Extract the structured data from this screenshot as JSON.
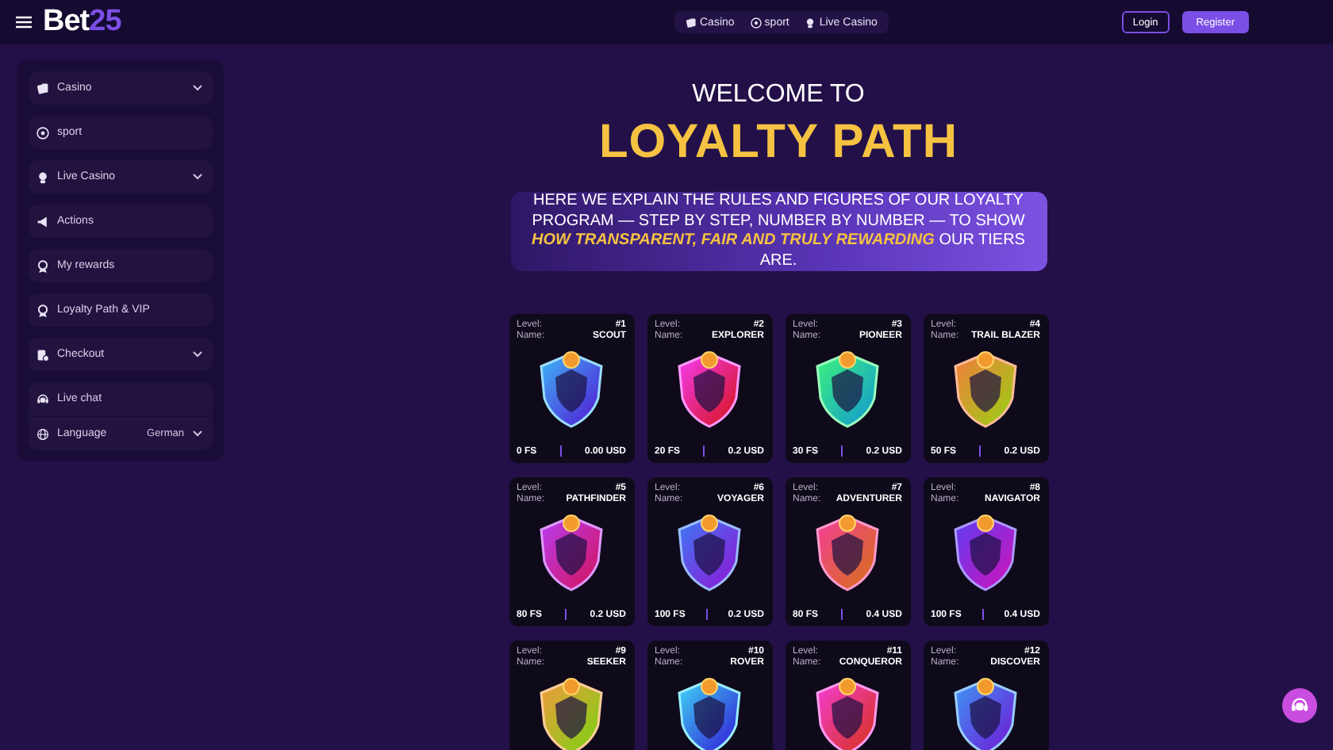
{
  "header": {
    "logo": {
      "text": "Bet",
      "accent": "25"
    },
    "nav": [
      {
        "label": "Casino"
      },
      {
        "label": "sport"
      },
      {
        "label": "Live Casino"
      }
    ],
    "buttons": [
      {
        "kind": "outline",
        "label": "Login"
      },
      {
        "kind": "filled",
        "label": "Register"
      }
    ]
  },
  "sidebar": {
    "items": [
      {
        "label": "Casino",
        "has_submenu": true
      },
      {
        "label": "sport",
        "has_submenu": false
      },
      {
        "label": "Live Casino",
        "has_submenu": true
      },
      {
        "label": "Actions",
        "has_submenu": false
      },
      {
        "label": "My rewards",
        "has_submenu": false
      },
      {
        "label": "Loyalty Path & VIP",
        "has_submenu": false
      },
      {
        "label": "Checkout",
        "has_submenu": true
      }
    ],
    "footer": {
      "chat": {
        "label": "Live chat"
      },
      "language": {
        "label": "Language",
        "value": "German"
      }
    }
  },
  "hero": {
    "kicker": "WELCOME TO",
    "title": "LOYALTY PATH",
    "description": "HERE WE EXPLAIN THE RULES AND FIGURES OF OUR LOYALTY PROGRAM — STEP BY STEP, NUMBER BY NUMBER — TO SHOW **HOW TRANSPARENT, FAIR AND TRULY REWARDING** OUR TIERS ARE."
  },
  "levels": [
    {
      "level_label": "Level:",
      "name_label": "Name:",
      "level": "#1",
      "name": "SCOUT",
      "spins": "0 FS",
      "value": "0.00 USD"
    },
    {
      "level_label": "Level:",
      "name_label": "Name:",
      "level": "#2",
      "name": "EXPLORER",
      "spins": "20 FS",
      "value": "0.2 USD"
    },
    {
      "level_label": "Level:",
      "name_label": "Name:",
      "level": "#3",
      "name": "PIONEER",
      "spins": "30 FS",
      "value": "0.2 USD"
    },
    {
      "level_label": "Level:",
      "name_label": "Name:",
      "level": "#4",
      "name": "TRAIL BLAZER",
      "spins": "50 FS",
      "value": "0.2 USD"
    },
    {
      "level_label": "Level:",
      "name_label": "Name:",
      "level": "#5",
      "name": "PATHFINDER",
      "spins": "80 FS",
      "value": "0.2 USD"
    },
    {
      "level_label": "Level:",
      "name_label": "Name:",
      "level": "#6",
      "name": "VOYAGER",
      "spins": "100 FS",
      "value": "0.2 USD"
    },
    {
      "level_label": "Level:",
      "name_label": "Name:",
      "level": "#7",
      "name": "ADVENTURER",
      "spins": "80 FS",
      "value": "0.4 USD"
    },
    {
      "level_label": "Level:",
      "name_label": "Name:",
      "level": "#8",
      "name": "NAVIGATOR",
      "spins": "100 FS",
      "value": "0.4 USD"
    },
    {
      "level_label": "Level:",
      "name_label": "Name:",
      "level": "#9",
      "name": "SEEKER"
    },
    {
      "level_label": "Level:",
      "name_label": "Name:",
      "level": "#10",
      "name": "ROVER"
    },
    {
      "level_label": "Level:",
      "name_label": "Name:",
      "level": "#11",
      "name": "CONQUEROR"
    },
    {
      "level_label": "Level:",
      "name_label": "Name:",
      "level": "#12",
      "name": "DISCOVER"
    }
  ]
}
